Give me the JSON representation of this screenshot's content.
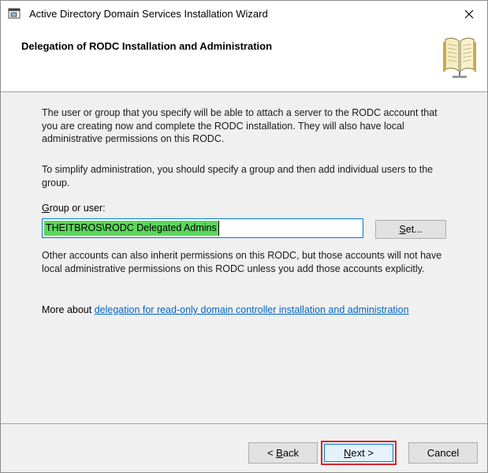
{
  "window": {
    "title": "Active Directory Domain Services Installation Wizard",
    "app_icon": "server-wizard-icon",
    "close_icon": "close-icon"
  },
  "header": {
    "title": "Delegation of RODC Installation and Administration",
    "icon": "open-book-icon"
  },
  "body": {
    "paragraph1": "The user or group that you specify will be able to attach a server to the RODC account that you are creating now and complete the RODC installation. They will also have local administrative permissions on this RODC.",
    "paragraph2": "To simplify administration, you should specify a group and then add individual users to the group.",
    "group_label_mnemonic": "G",
    "group_label_rest": "roup or user:",
    "group_value": "THEITBROS\\RODC Delegated Admins",
    "set_button_mnemonic": "S",
    "set_button_rest": "et...",
    "paragraph3": "Other accounts can also inherit permissions on this RODC, but those accounts will not have local administrative permissions on this RODC unless you add those accounts explicitly.",
    "more_prefix": "More about ",
    "more_link": "delegation for read-only domain controller installation and administration"
  },
  "footer": {
    "back_prefix": "< ",
    "back_mnemonic": "B",
    "back_rest": "ack",
    "next_mnemonic": "N",
    "next_rest": "ext >",
    "cancel_label": "Cancel"
  },
  "colors": {
    "highlight": "#5cd65c",
    "link": "#0066cc",
    "callout_border": "#d4262b",
    "focus_border": "#0078d7"
  }
}
